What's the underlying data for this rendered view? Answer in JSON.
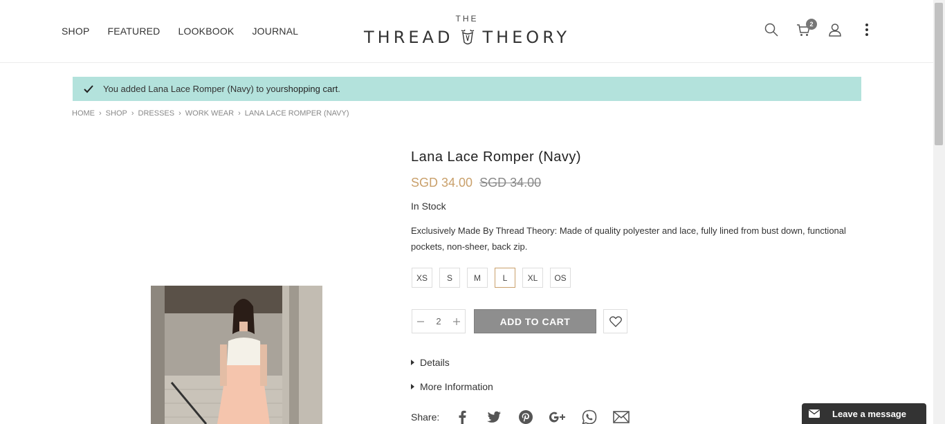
{
  "nav": {
    "items": [
      "SHOP",
      "FEATURED",
      "LOOKBOOK",
      "JOURNAL"
    ]
  },
  "logo": {
    "small": "THE",
    "left": "THREAD",
    "right": "THEORY"
  },
  "header_icons": {
    "cart_count": "2"
  },
  "message": {
    "prefix": "You added Lana Lace Romper (Navy) to your ",
    "link": "shopping cart",
    "suffix": "."
  },
  "breadcrumb": [
    "HOME",
    "SHOP",
    "DRESSES",
    "WORK WEAR",
    "LANA LACE ROMPER (NAVY)"
  ],
  "product": {
    "title": "Lana Lace Romper (Navy)",
    "price": "SGD 34.00",
    "old_price": "SGD 34.00",
    "stock": "In Stock",
    "description": "Exclusively Made By Thread Theory: Made of quality polyester and lace, fully lined from bust down, functional pockets, non-sheer, back zip.",
    "sizes": [
      "XS",
      "S",
      "M",
      "L",
      "XL",
      "OS"
    ],
    "selected_size": "L",
    "quantity": "2",
    "add_to_cart": "ADD TO CART",
    "details_label": "Details",
    "more_info_label": "More Information",
    "share_label": "Share:"
  },
  "chat": {
    "label": "Leave a message"
  },
  "colors": {
    "accent": "#c9a06b",
    "message_bg": "#b3e2dc",
    "button": "#8e8e8e"
  }
}
